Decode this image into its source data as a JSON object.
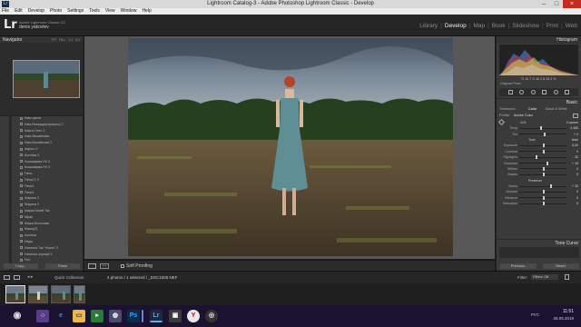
{
  "window": {
    "title": "Lightroom Catalog-3 - Adobe Photoshop Lightroom Classic - Develop"
  },
  "menu": [
    "File",
    "Edit",
    "Develop",
    "Photo",
    "Settings",
    "Tools",
    "View",
    "Window",
    "Help"
  ],
  "identity": {
    "logo": "Lr",
    "catalog": "Adobe Lightroom Classic CC",
    "user": "denis yakovlev"
  },
  "modules": [
    "Library",
    "Develop",
    "Map",
    "Book",
    "Slideshow",
    "Print",
    "Web"
  ],
  "active_module": "Develop",
  "left_panel": {
    "navigator_label": "Navigator",
    "navigator_opts": [
      "FIT",
      "FILL",
      "1:1",
      "3:1"
    ],
    "presets": [
      "Kata цвета",
      "Kata Впереди(страшно) 2",
      "Kata в Опег 2",
      "Kata Михайлова",
      "Kata Михайлова 2",
      "нарост 2",
      "Котейка 2",
      "Кошкаарма НЧ 3",
      "Кошкаарма НЧ 3",
      "Печи",
      "Печи(?) 3",
      "Печи3",
      "Печи3",
      "Марина 2",
      "Марина 2",
      "Мария Моей Так",
      "Мраи",
      "Маша Болотова",
      "Маша(2)",
      "ностяка",
      "Ниди",
      "Наталья Так \"Ночке\" 2",
      "Наталья черный 2",
      "Пят"
    ],
    "copy_button": "Copy...",
    "paste_button": "Paste"
  },
  "center": {
    "soft_proofing": "Soft Proofing"
  },
  "right_panel": {
    "histogram_label": "Histogram",
    "histogram_info": "R 40,7 G 46,3 B 45,3 %",
    "original_photo": "Original Photo",
    "basic_label": "Basic",
    "treatment_label": "Treatment:",
    "treatment_options": [
      "Color",
      "Black & White"
    ],
    "profile_label": "Profile:",
    "profile_value": "Adobe Color",
    "wb_label": "WB:",
    "wb_value": "Custom",
    "temp_tint": [
      {
        "label": "Temp",
        "value": "4 450"
      },
      {
        "label": "Tint",
        "value": "+ 2"
      }
    ],
    "tone_label": "Tone",
    "tone_auto": "Auto",
    "tone_sliders": [
      {
        "label": "Exposure",
        "value": "0,00"
      },
      {
        "label": "Contrast",
        "value": "0"
      }
    ],
    "tone_sliders2": [
      {
        "label": "Highlights",
        "value": "- 32"
      },
      {
        "label": "Shadows",
        "value": "+ 15"
      },
      {
        "label": "Whites",
        "value": "0"
      },
      {
        "label": "Blacks",
        "value": "0"
      }
    ],
    "presence_label": "Presence",
    "presence_sliders": [
      {
        "label": "Clarity",
        "value": "+ 32"
      },
      {
        "label": "Dehaze",
        "value": "0"
      },
      {
        "label": "Vibrance",
        "value": "0"
      },
      {
        "label": "Saturation",
        "value": "0"
      }
    ],
    "tone_curve_label": "Tone Curve",
    "previous_button": "Previous",
    "reset_button": "Reset"
  },
  "filmbar": {
    "quick_collection": "Quick Collection",
    "selection_info": "4 photos / 1 selected / _DSC1500.NEF",
    "filter_label": "Filter:",
    "filter_value": "Filters Off"
  },
  "taskbar": {
    "lang": "РУС",
    "time": "11:51",
    "date": "26.05.2019"
  }
}
